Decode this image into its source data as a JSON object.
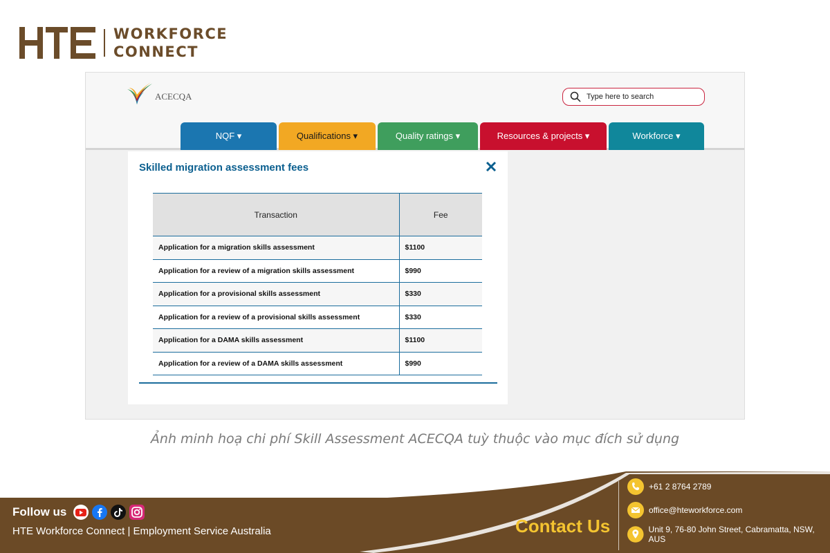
{
  "brand": {
    "line1": "WORKFORCE",
    "line2": "CONNECT"
  },
  "site": {
    "logo_text": "ACECQA",
    "search_placeholder": "Type here to search",
    "tabs": [
      {
        "label": "NQF ▾",
        "color": "#1b76b0"
      },
      {
        "label": "Qualifications ▾",
        "color": "#f2a823"
      },
      {
        "label": "Quality ratings ▾",
        "color": "#3f9e5d"
      },
      {
        "label": "Resources & projects ▾",
        "color": "#c8102e"
      },
      {
        "label": "Workforce ▾",
        "color": "#10879b"
      }
    ]
  },
  "modal": {
    "title": "Skilled migration assessment fees",
    "columns": [
      "Transaction",
      "Fee"
    ],
    "rows": [
      {
        "transaction": "Application for a migration skills assessment",
        "fee": "$1100"
      },
      {
        "transaction": "Application for a review of a migration skills assessment",
        "fee": "$990"
      },
      {
        "transaction": "Application for a provisional skills assessment",
        "fee": "$330"
      },
      {
        "transaction": "Application for a review of a provisional skills assessment",
        "fee": "$330"
      },
      {
        "transaction": "Application for a DAMA skills assessment",
        "fee": "$1100"
      },
      {
        "transaction": "Application for a review of a DAMA skills assessment",
        "fee": "$990"
      }
    ]
  },
  "caption": "Ảnh minh hoạ chi phí Skill Assessment ACECQA tuỳ thuộc vào mục đích sử dụng",
  "footer": {
    "follow_label": "Follow us",
    "company": "HTE Workforce Connect | Employment Service Australia",
    "contact_title": "Contact Us",
    "phone": "+61 2 8764 2789",
    "email": "office@hteworkforce.com",
    "address": "Unit 9, 76-80 John Street, Cabramatta, NSW, AUS"
  },
  "colors": {
    "brand_brown": "#6b4c2a",
    "accent_yellow": "#f4c430",
    "link_blue": "#0b5f8f"
  }
}
